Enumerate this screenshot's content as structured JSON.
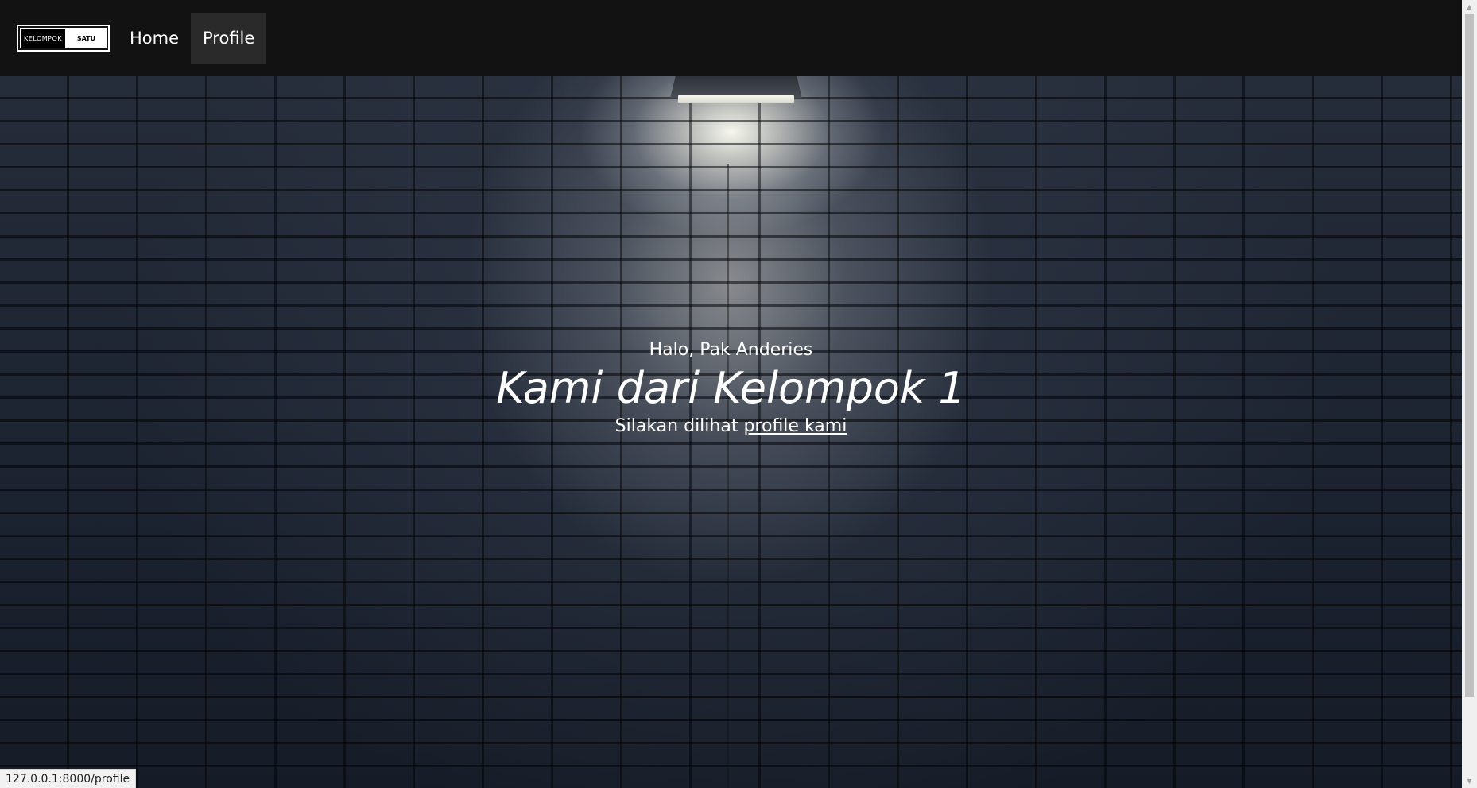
{
  "navbar": {
    "logo": {
      "left_text": "KELOMPOK",
      "right_text": "SATU"
    },
    "links": [
      {
        "label": "Home"
      },
      {
        "label": "Profile"
      }
    ]
  },
  "hero": {
    "greeting": "Halo, Pak Anderies",
    "headline": "Kami dari Kelompok 1",
    "subline_prefix": "Silakan dilihat ",
    "subline_link": "profile kami"
  },
  "status_bar": {
    "url": "127.0.0.1:8000/profile"
  }
}
